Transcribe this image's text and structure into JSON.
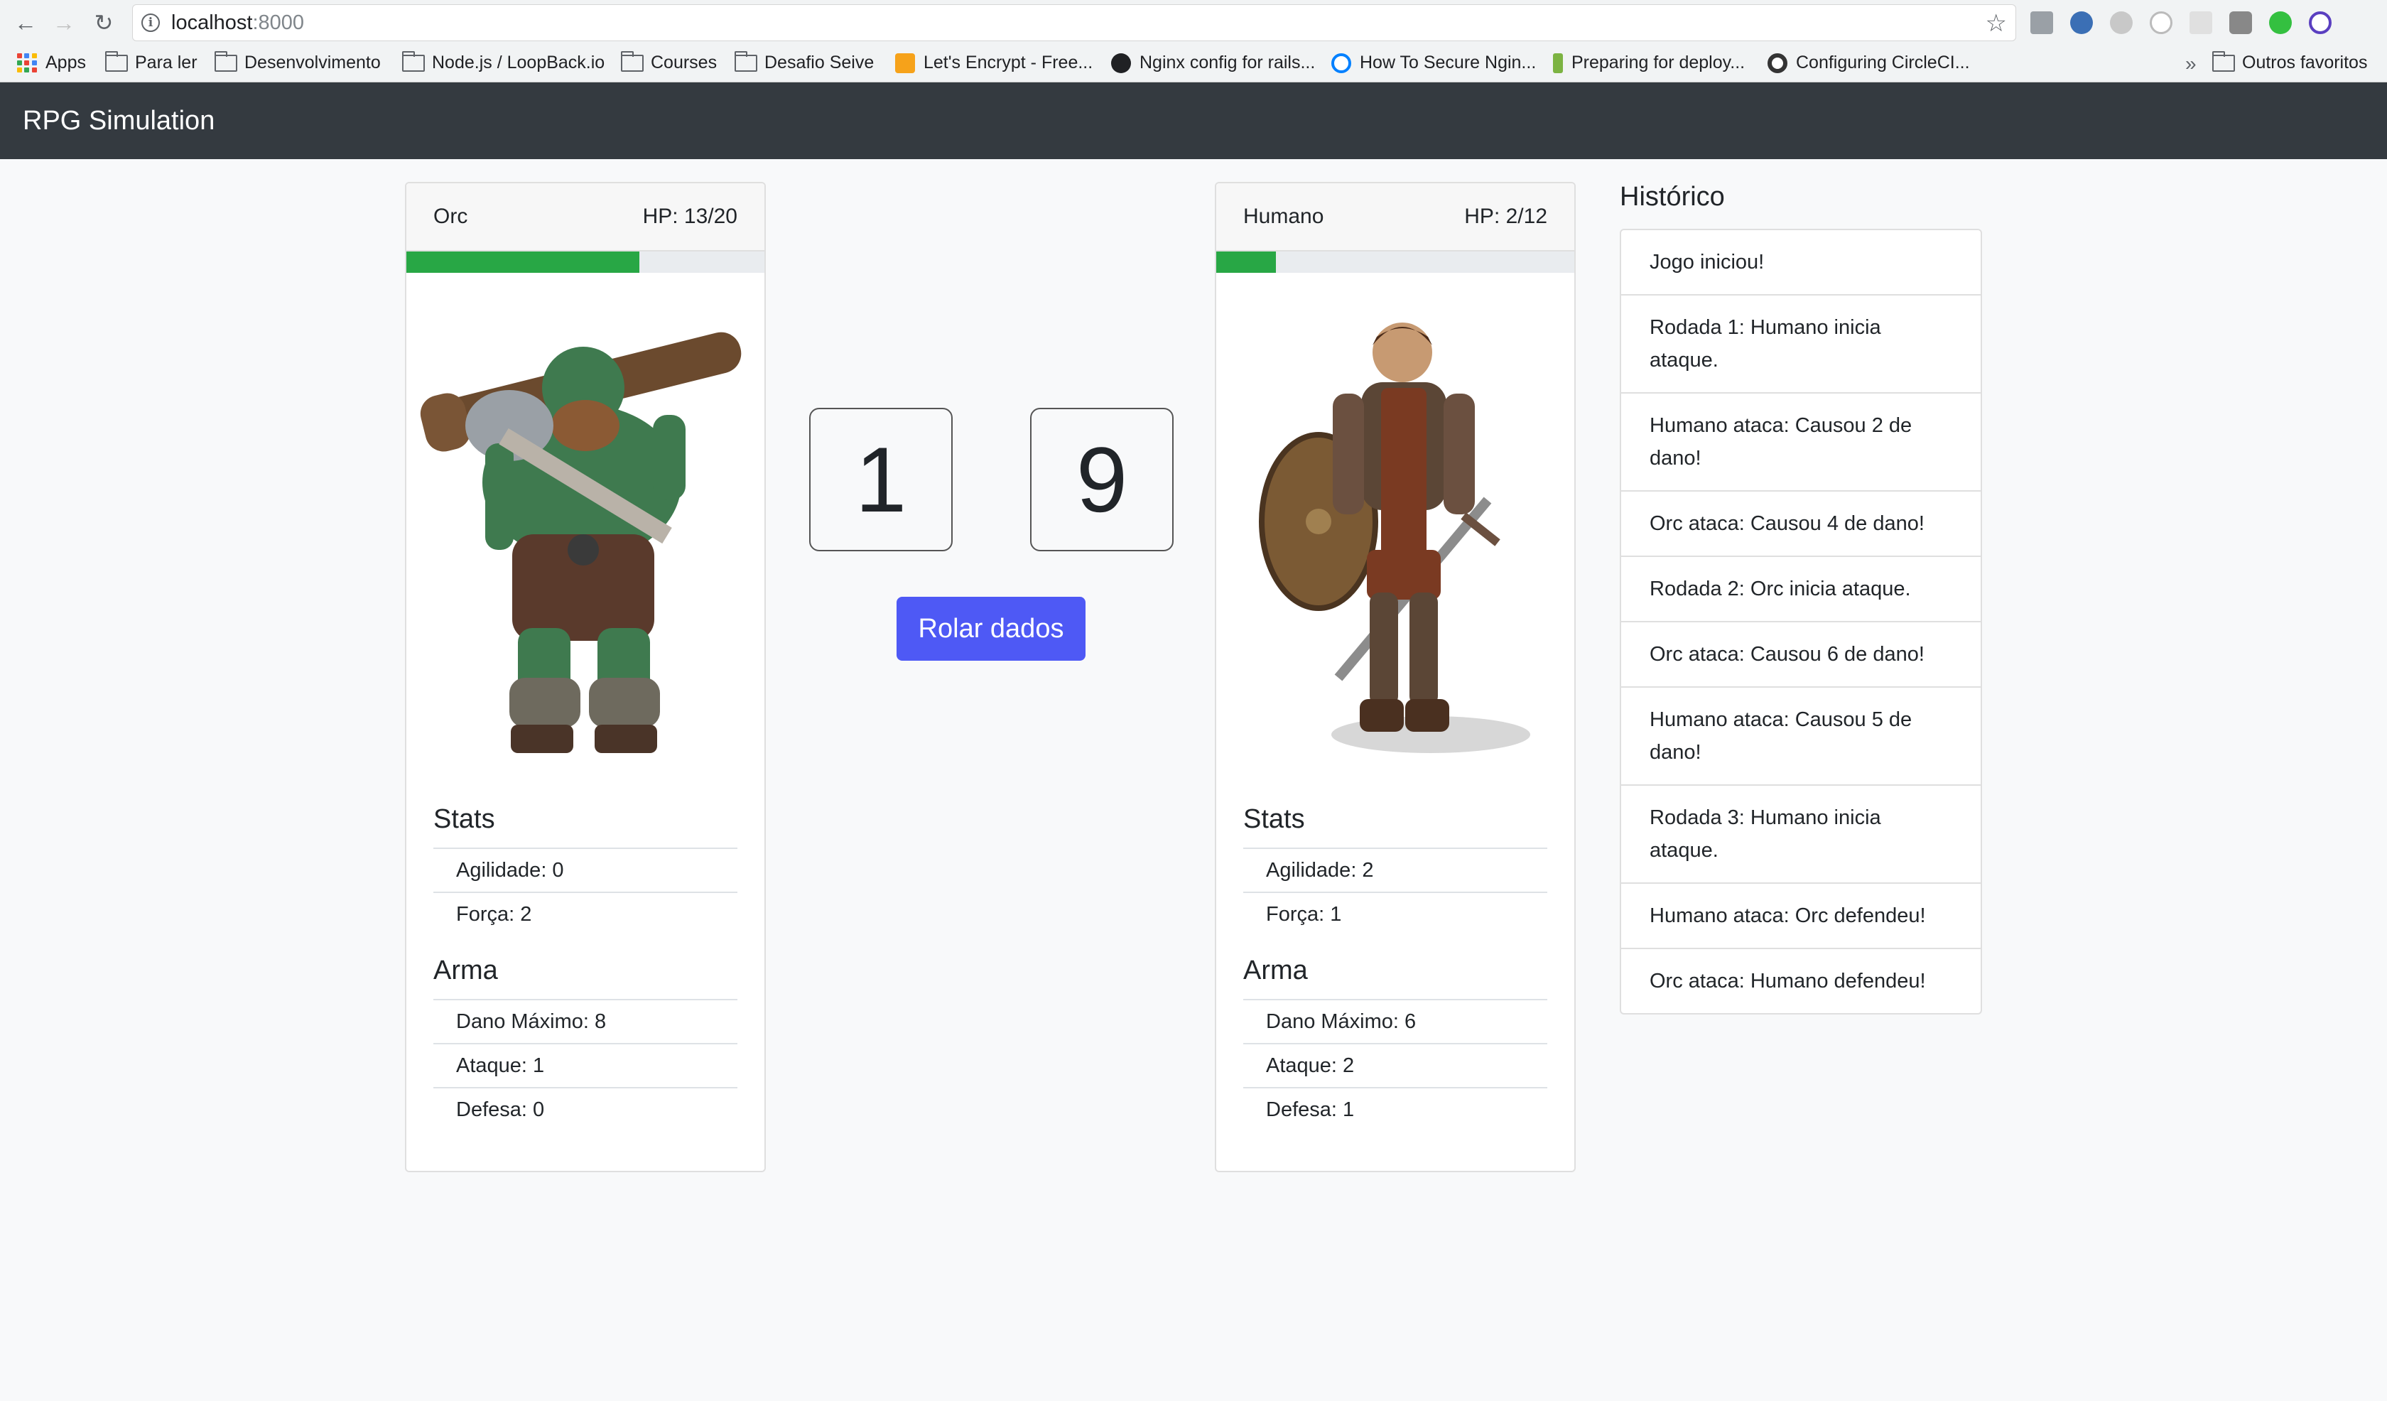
{
  "browser": {
    "url_host": "localhost",
    "url_port": ":8000",
    "bookmarks": [
      {
        "label": "Apps",
        "icon": "apps-grid-icon"
      },
      {
        "label": "Para ler",
        "icon": "folder-icon"
      },
      {
        "label": "Desenvolvimento",
        "icon": "folder-icon"
      },
      {
        "label": "Node.js / LoopBack.io",
        "icon": "folder-icon"
      },
      {
        "label": "Courses",
        "icon": "folder-icon"
      },
      {
        "label": "Desafio Seive",
        "icon": "folder-icon"
      },
      {
        "label": "Let's Encrypt - Free...",
        "icon": "letsencrypt-icon"
      },
      {
        "label": "Nginx config for rails...",
        "icon": "github-icon"
      },
      {
        "label": "How To Secure Ngin...",
        "icon": "digitalocean-icon"
      },
      {
        "label": "Preparing for deploy...",
        "icon": "bitbucket-icon"
      },
      {
        "label": "Configuring CircleCI...",
        "icon": "circleci-icon"
      },
      {
        "label": "Outros favoritos",
        "icon": "folder-icon"
      }
    ],
    "overflow_label": "»"
  },
  "app": {
    "title": "RPG Simulation"
  },
  "orc": {
    "name": "Orc",
    "hp_label": "HP: 13/20",
    "hp_fraction": 0.65,
    "stats_title": "Stats",
    "stats": [
      "Agilidade: 0",
      "Força: 2"
    ],
    "weapon_title": "Arma",
    "weapon": [
      "Dano Máximo: 8",
      "Ataque: 1",
      "Defesa: 0"
    ],
    "skin_color": "#3f7a4f"
  },
  "human": {
    "name": "Humano",
    "hp_label": "HP: 2/12",
    "hp_fraction": 0.1667,
    "stats_title": "Stats",
    "stats": [
      "Agilidade: 2",
      "Força: 1"
    ],
    "weapon_title": "Arma",
    "weapon": [
      "Dano Máximo: 6",
      "Ataque: 2",
      "Defesa: 1"
    ],
    "armor_color": "#7a3a22"
  },
  "dice": {
    "left": "1",
    "right": "9",
    "roll_label": "Rolar dados"
  },
  "history": {
    "title": "Histórico",
    "items": [
      "Jogo iniciou!",
      "Rodada 1: Humano inicia ataque.",
      "Humano ataca: Causou 2 de dano!",
      "Orc ataca: Causou 4 de dano!",
      "Rodada 2: Orc inicia ataque.",
      "Orc ataca: Causou 6 de dano!",
      "Humano ataca: Causou 5 de dano!",
      "Rodada 3: Humano inicia ataque.",
      "Humano ataca: Orc defendeu!",
      "Orc ataca: Humano defendeu!"
    ]
  },
  "colors": {
    "navbar": "#343a40",
    "hp_fill": "#28a745",
    "button": "#4e59f5"
  }
}
